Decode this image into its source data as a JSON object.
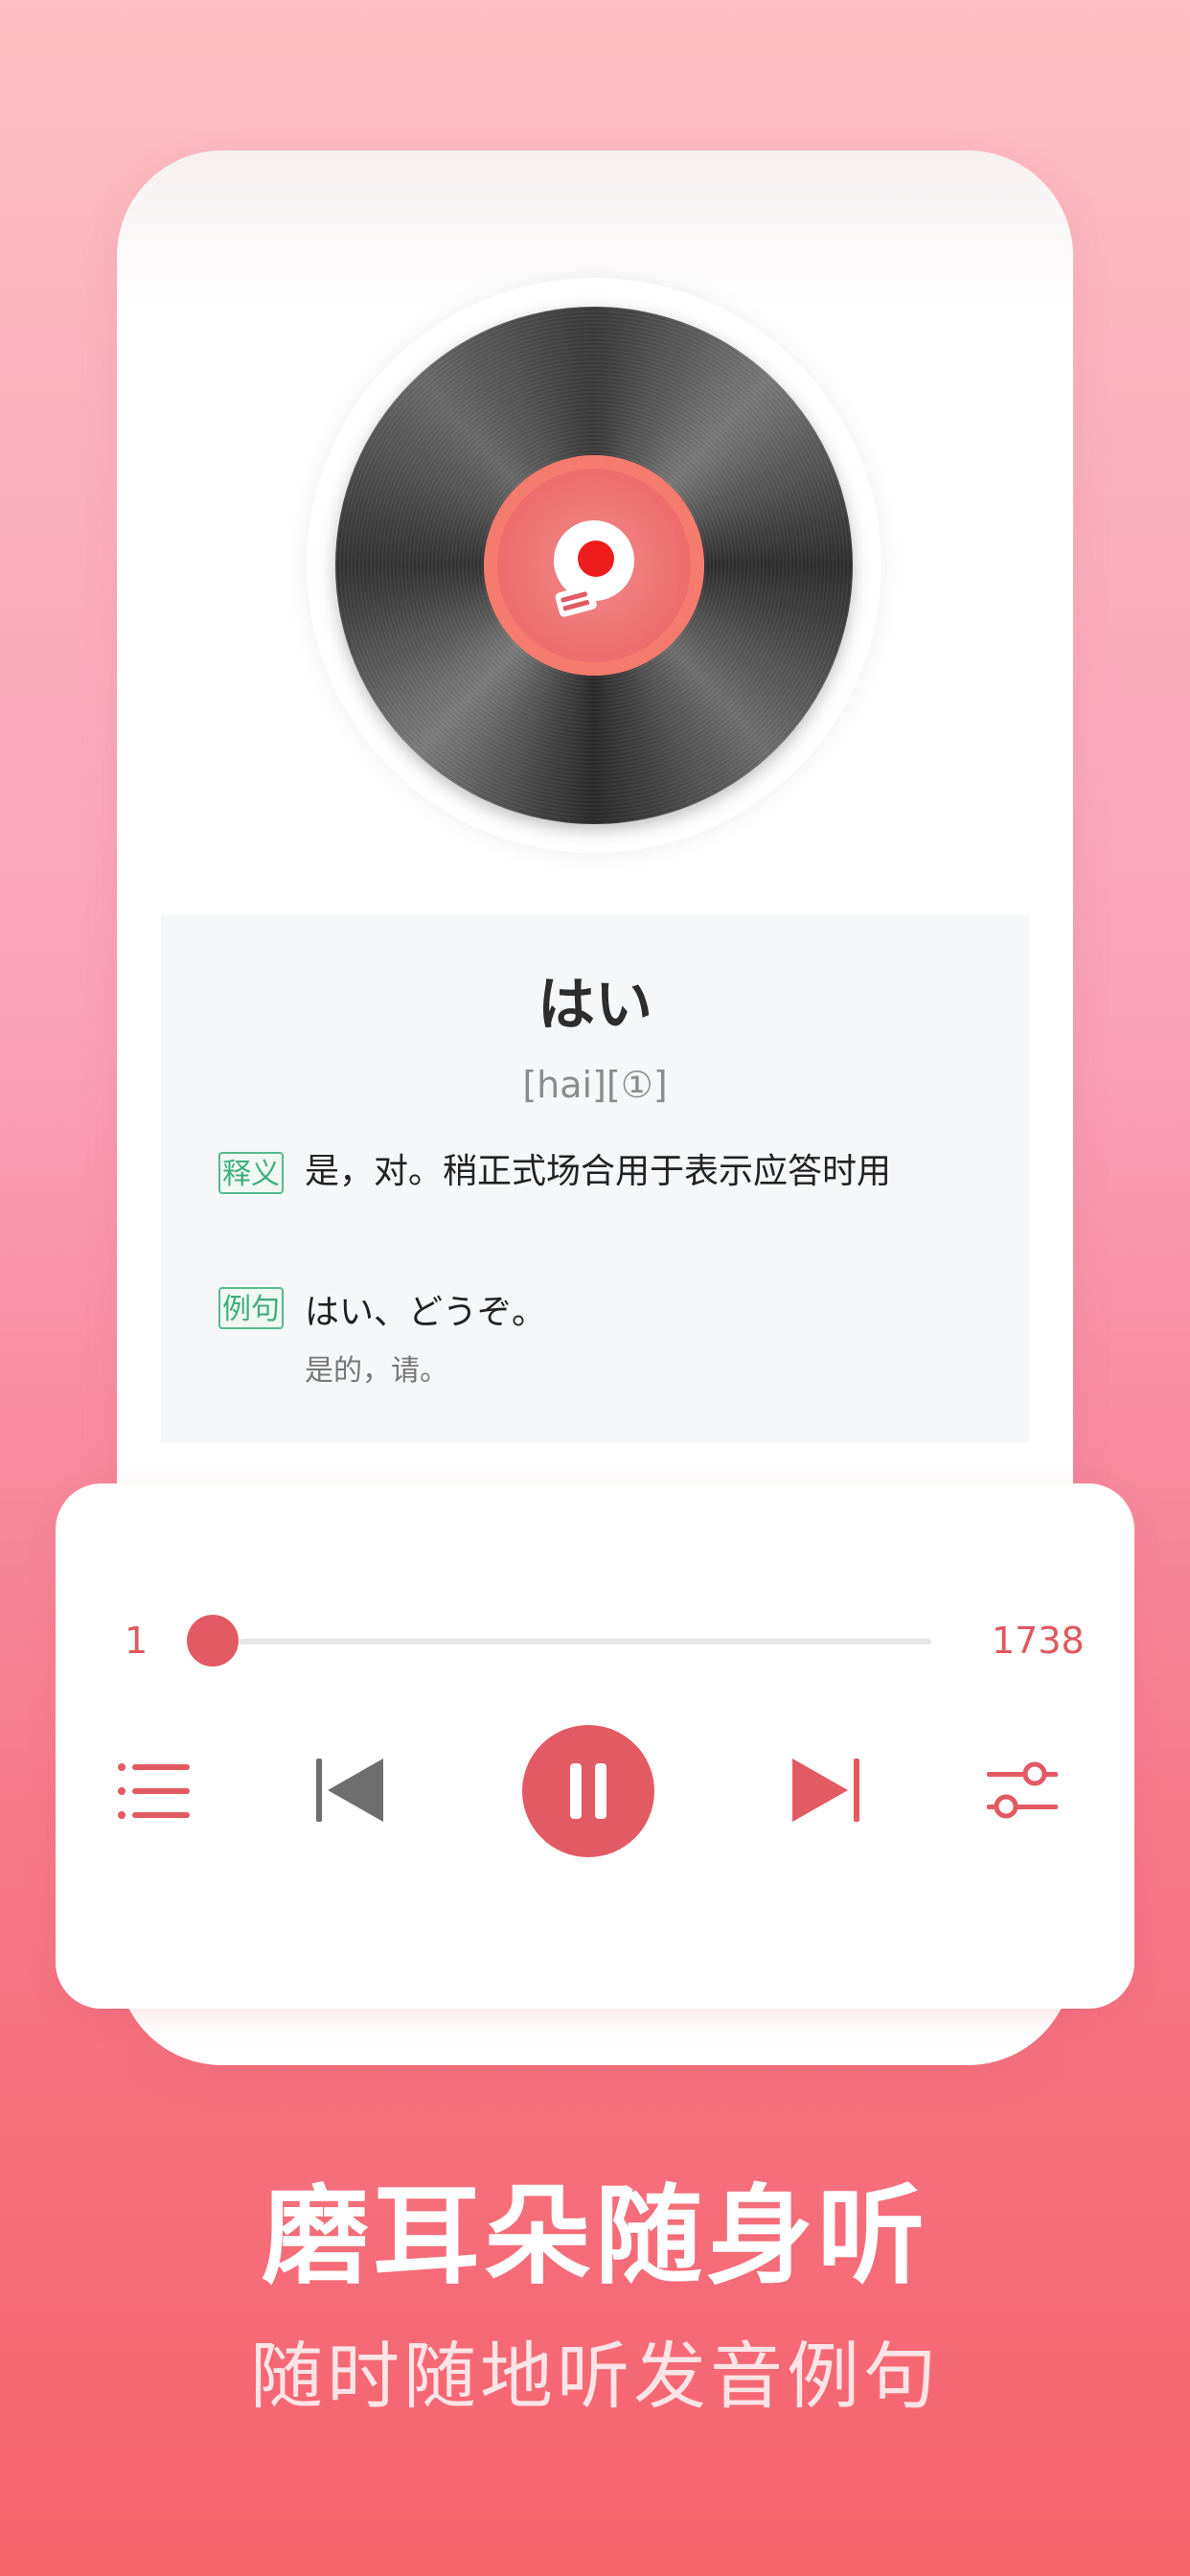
{
  "word": {
    "kana": "はい",
    "phonetic": "[hai][①]",
    "definition_tag": "释义",
    "definition": "是，对。稍正式场合用于表示应答时用",
    "example_tag": "例句",
    "example": "はい、どうぞ。",
    "example_translation": "是的，请。"
  },
  "player": {
    "current": "1",
    "total": "1738",
    "progress": 0.0,
    "state": "playing"
  },
  "promo": {
    "headline": "磨耳朵随身听",
    "subline": "随时随地听发音例句"
  },
  "colors": {
    "accent": "#e25a63",
    "tag_green": "#3fae7d"
  },
  "icons": [
    "vinyl-disc",
    "app-logo-icon",
    "playlist-icon",
    "previous-icon",
    "pause-icon",
    "next-icon",
    "settings-sliders-icon"
  ]
}
